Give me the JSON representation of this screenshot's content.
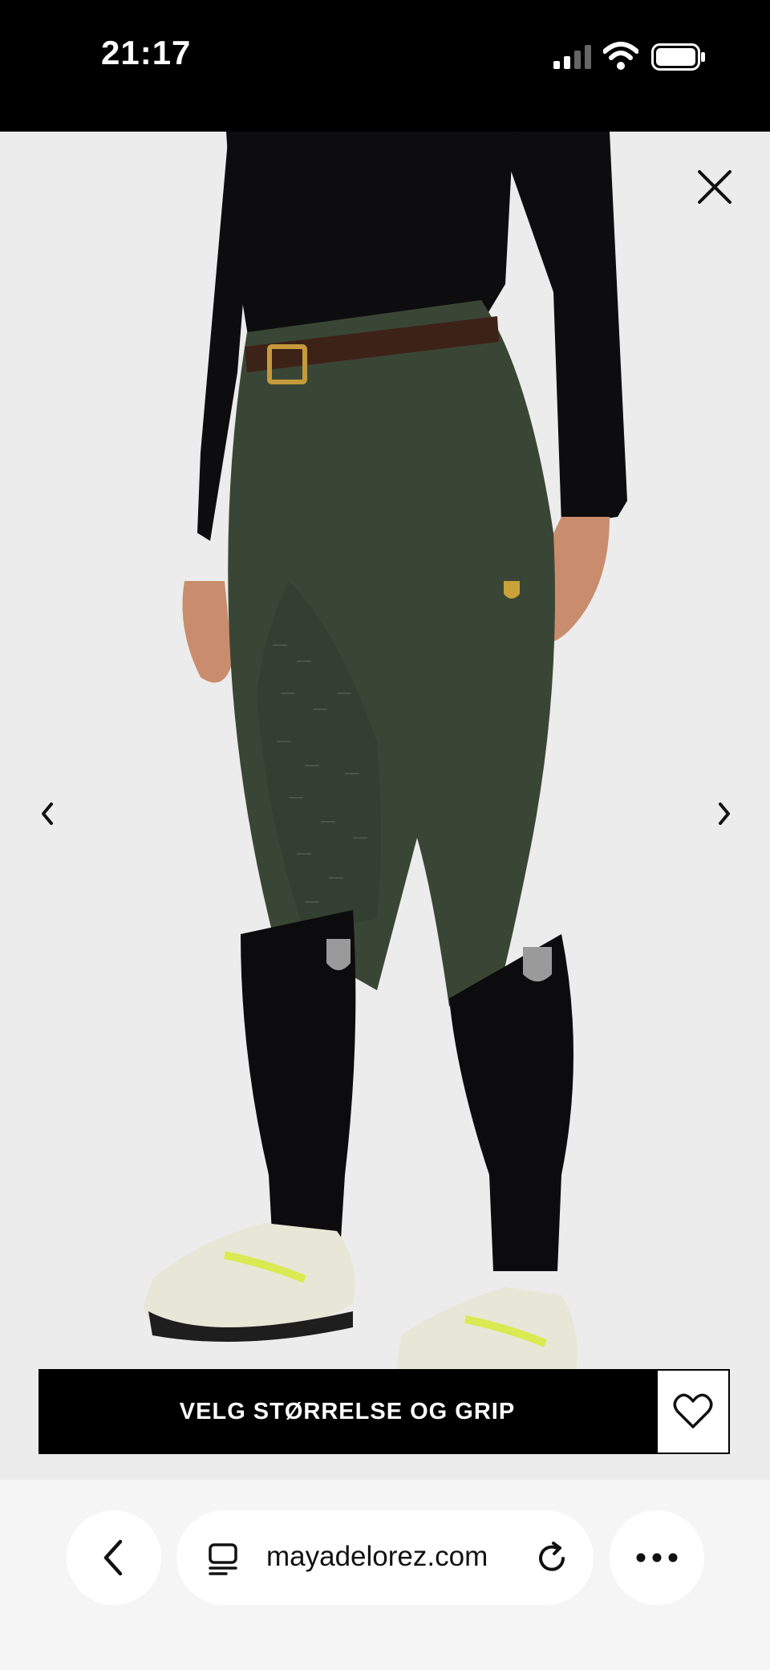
{
  "status_bar": {
    "time": "21:17"
  },
  "product_viewer": {
    "icons": {
      "close": "close-icon",
      "prev": "chevron-left-icon",
      "next": "chevron-right-icon"
    }
  },
  "actions": {
    "cta_label": "VELG STØRRELSE OG GRIP",
    "favorite_icon": "heart-icon"
  },
  "browser": {
    "url": "mayadelorez.com"
  }
}
